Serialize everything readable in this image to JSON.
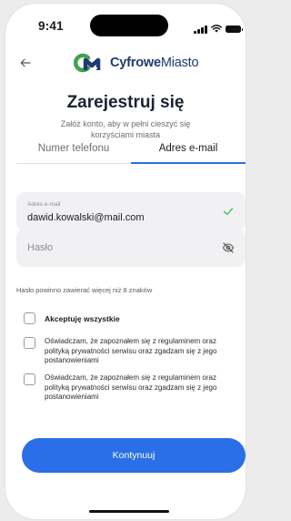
{
  "status_bar": {
    "time": "9:41",
    "icons": [
      "signal-icon",
      "wifi-icon",
      "battery-icon"
    ]
  },
  "header": {
    "back_icon": "arrow-left-icon",
    "logo": {
      "bold": "Cyfrowe",
      "light": "Miasto",
      "icon": "cyfrowe-miasto-logo-icon"
    }
  },
  "page": {
    "title": "Zarejestruj się",
    "subtitle": "Załóż konto, aby w pełni cieszyć się korzyściami miasta"
  },
  "tabs": [
    {
      "label": "Numer telefonu",
      "active": false
    },
    {
      "label": "Adres e-mail",
      "active": true
    }
  ],
  "form": {
    "email": {
      "label": "Adres e-mail",
      "value": "dawid.kowalski@mail.com",
      "status_icon": "check-icon"
    },
    "password": {
      "placeholder": "Hasło",
      "toggle_icon": "eye-off-icon"
    },
    "password_hint": "Hasło powinno zawierać więcej niż 8 znaków"
  },
  "consents": {
    "accept_all": "Akceptuję wszystkie",
    "items": [
      "Oświadczam, że zapoznałem się z regulaminem oraz polityką prywatności serwisu oraz zgadzam się z jego postanowieniami",
      "Oświadczam, że zapoznałem się z regulaminem oraz polityką prywatności serwisu oraz zgadzam się z jego postanowieniami"
    ]
  },
  "actions": {
    "continue_label": "Kontynuuj"
  },
  "colors": {
    "accent": "#2a6fe8",
    "brand_navy": "#1f3a70",
    "brand_green": "#3fa34d",
    "success": "#34c759"
  }
}
